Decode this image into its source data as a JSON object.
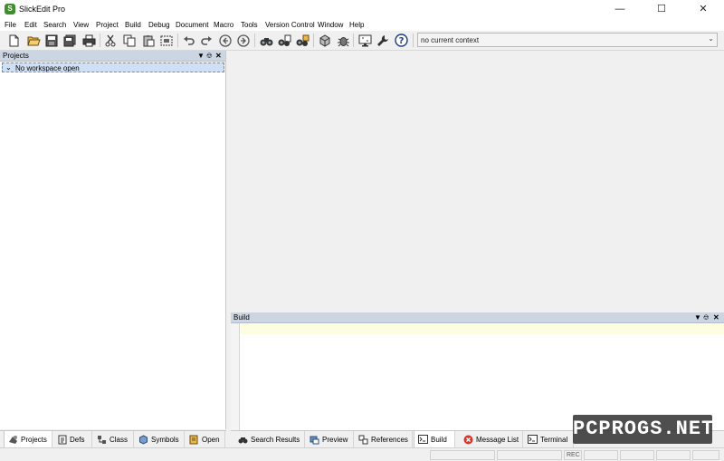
{
  "window": {
    "title": "SlickEdit Pro",
    "icon_letter": "S"
  },
  "menu": [
    "File",
    "Edit",
    "Search",
    "View",
    "Project",
    "Build",
    "Debug",
    "Document",
    "Macro",
    "Tools",
    "Version Control",
    "Window",
    "Help"
  ],
  "toolbar": {
    "buttons": [
      "new-file-icon",
      "open-file-icon",
      "save-icon",
      "save-all-icon",
      "print-icon",
      "cut-icon",
      "copy-icon",
      "paste-icon",
      "select-icon",
      "undo-icon",
      "redo-icon",
      "back-icon",
      "forward-icon",
      "find-icon",
      "find-in-files-icon",
      "find-symbol-icon",
      "build-icon",
      "debug-icon",
      "remote-icon",
      "tools-icon",
      "help-icon"
    ],
    "context_value": "no current context"
  },
  "projects_panel": {
    "title": "Projects",
    "tree_item": "No workspace open"
  },
  "build_panel": {
    "title": "Build"
  },
  "left_tabs": [
    "Projects",
    "Defs",
    "Class",
    "Symbols",
    "Open"
  ],
  "bottom_tabs": [
    "Search Results",
    "Preview",
    "References",
    "Build",
    "Message List",
    "Terminal"
  ],
  "status": {
    "rec": "REC"
  },
  "watermark": "PCPROGS.NET",
  "colors": {
    "panel_header": "#ccd6e3",
    "tree_selection": "#cfe0f4",
    "build_current_line": "#fdfde0",
    "app_icon": "#3f8f2f"
  }
}
